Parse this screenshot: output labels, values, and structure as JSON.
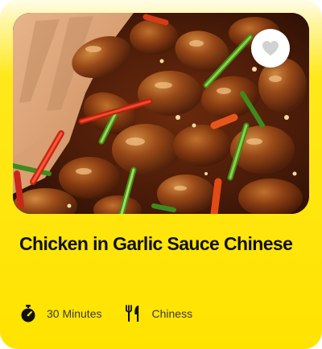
{
  "card": {
    "title": "Chicken in Garlic Sauce Chinese",
    "image_icon": "dish-photo",
    "favorite_icon": "heart-icon",
    "duration": {
      "icon": "timer-icon",
      "text": "30 Minutes"
    },
    "cuisine": {
      "icon": "fork-knife-icon",
      "text": "Chiness"
    }
  },
  "colors": {
    "card_background": "#ffe300",
    "title_text": "#111111",
    "meta_text": "#3a3a3a",
    "favorite_button": "#ffffff",
    "heart": "#d2d2d2"
  }
}
